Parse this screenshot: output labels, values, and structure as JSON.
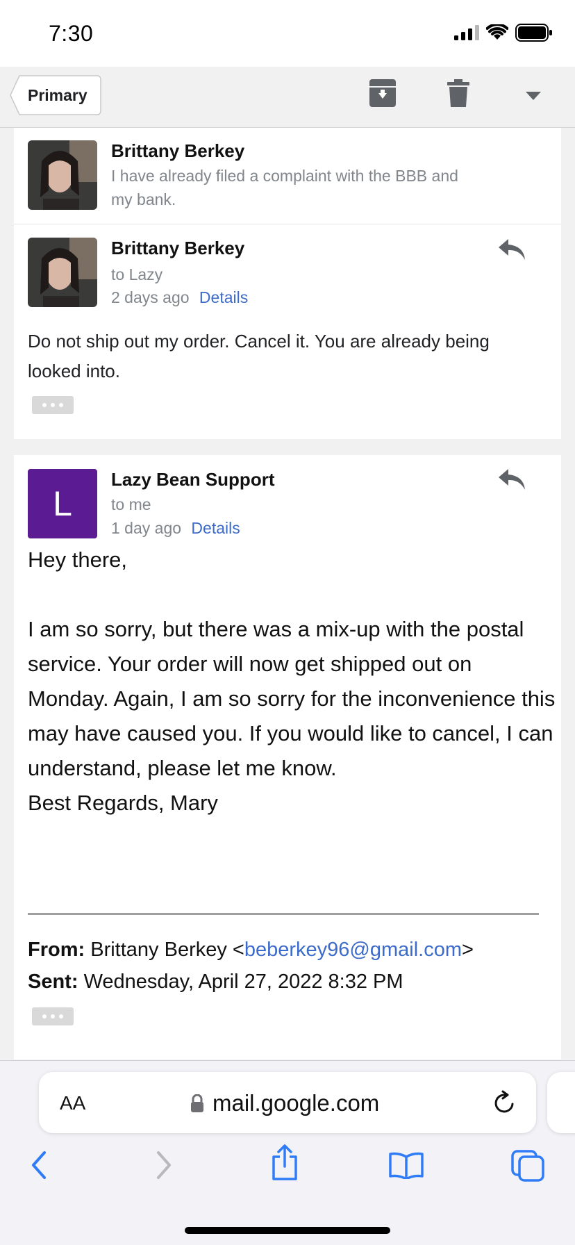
{
  "status_bar": {
    "time": "7:30"
  },
  "toolbar": {
    "back_label": "Primary",
    "icons": [
      "archive-icon",
      "trash-icon",
      "dropdown-icon"
    ]
  },
  "thread": {
    "collapsed": {
      "sender": "Brittany Berkey",
      "snippet": "I have already filed a complaint with the BBB and my bank."
    },
    "message1": {
      "sender": "Brittany Berkey",
      "to": "to Lazy",
      "time": "2 days ago",
      "details": "Details",
      "body": "Do not ship out my order. Cancel it. You are already being looked into."
    },
    "message2": {
      "avatar_letter": "L",
      "sender": "Lazy Bean Support",
      "to": "to me",
      "time": "1 day ago",
      "details": "Details",
      "greeting": "Hey there,",
      "paragraph": "I am so sorry, but there was a mix-up with the postal service. Your order will now get shipped out on Monday. Again, I am so sorry for the inconvenience this may have caused you. If you would like to cancel, I can understand, please let me know.",
      "signoff": "Best Regards, Mary",
      "quoted": {
        "from_label": "From:",
        "from_name": "Brittany Berkey <",
        "from_email": "beberkey96@gmail.com",
        "from_close": ">",
        "sent_label": "Sent:",
        "sent_value": "Wednesday, April 27, 2022 8:32 PM"
      }
    }
  },
  "browser": {
    "text_size_label": "AA",
    "url": "mail.google.com",
    "nav_icons": [
      "back-icon",
      "forward-icon",
      "share-icon",
      "bookmarks-icon",
      "tabs-icon"
    ]
  },
  "colors": {
    "link": "#3c6bc9",
    "avatar_bg": "#5b1b92",
    "safari_blue": "#2f7cf6"
  }
}
